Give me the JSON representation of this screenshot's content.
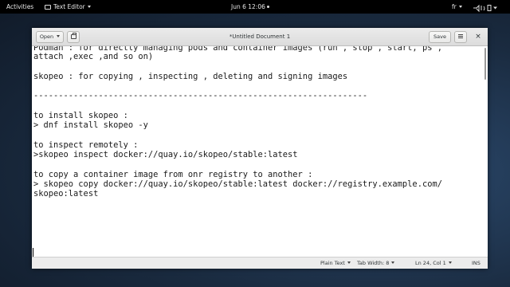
{
  "topbar": {
    "activities": "Activities",
    "app_menu": "Text Editor",
    "clock": "Jun 6  12:06",
    "keyboard_layout": "fr"
  },
  "window": {
    "title": "*Untitled Document 1",
    "open_label": "Open",
    "save_label": "Save"
  },
  "editor": {
    "lines": [
      "Podman : for directly managing pods and container images (run , stop , start, ps ,",
      "attach ,exec ,and so on)",
      "",
      "skopeo : for copying , inspecting , deleting and signing images",
      "",
      "-------------------------------------------------------------------",
      "",
      "to install skopeo :",
      "> dnf install skopeo -y",
      "",
      "to inspect remotely :",
      ">skopeo inspect docker://quay.io/skopeo/stable:latest",
      "",
      "to copy a container image from onr registry to another :",
      "> skopeo copy docker://quay.io/skopeo/stable:latest docker://registry.example.com/",
      "skopeo:latest"
    ]
  },
  "statusbar": {
    "language": "Plain Text",
    "tab_width": "Tab Width: 8",
    "position": "Ln 24, Col 1",
    "mode": "INS"
  }
}
